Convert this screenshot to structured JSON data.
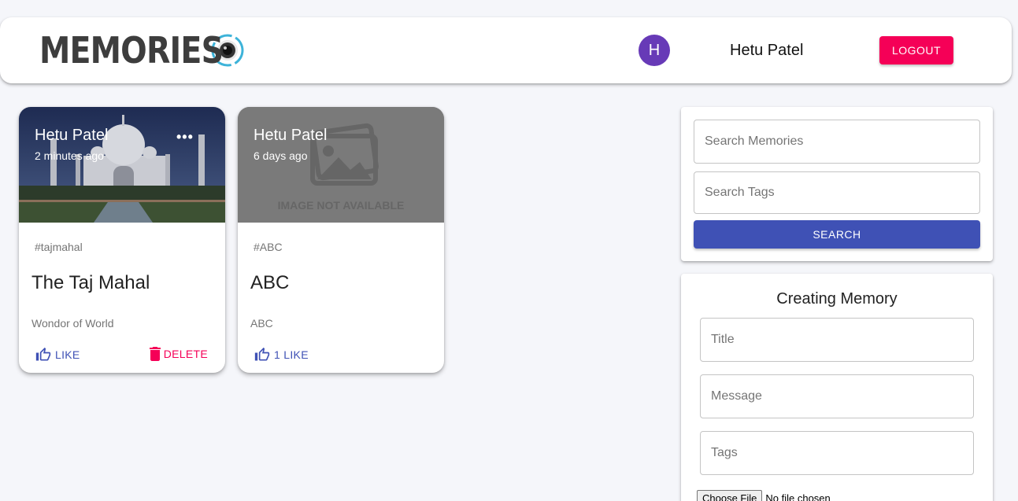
{
  "header": {
    "brand": "MEMORIES",
    "avatar_initial": "H",
    "username": "Hetu Patel",
    "logout_label": "LOGOUT"
  },
  "posts": [
    {
      "author": "Hetu Patel",
      "time": "2 minutes ago",
      "more": "•••",
      "tags": "#tajmahal",
      "title": "The Taj Mahal",
      "message": "Wondor of World",
      "like_label": "LIKE",
      "delete_label": "DELETE"
    },
    {
      "author": "Hetu Patel",
      "time": "6 days ago",
      "image_placeholder": "IMAGE NOT AVAILABLE",
      "tags": "#ABC",
      "title": "ABC",
      "message": "ABC",
      "like_label": "1 LIKE"
    }
  ],
  "search": {
    "memories_placeholder": "Search Memories",
    "tags_placeholder": "Search Tags",
    "button_label": "SEARCH"
  },
  "form": {
    "heading": "Creating Memory",
    "title_placeholder": "Title",
    "message_placeholder": "Message",
    "tags_placeholder": "Tags",
    "file_button": "Choose File",
    "file_status": "No file chosen"
  },
  "colors": {
    "primary": "#3f51b5",
    "secondary": "#f50057",
    "avatar": "#673ab7",
    "background": "#f5f6fa"
  },
  "icons": [
    "camera-lens-icon",
    "thumb-up-icon",
    "trash-icon",
    "more-horiz-icon",
    "image-placeholder-icon"
  ]
}
